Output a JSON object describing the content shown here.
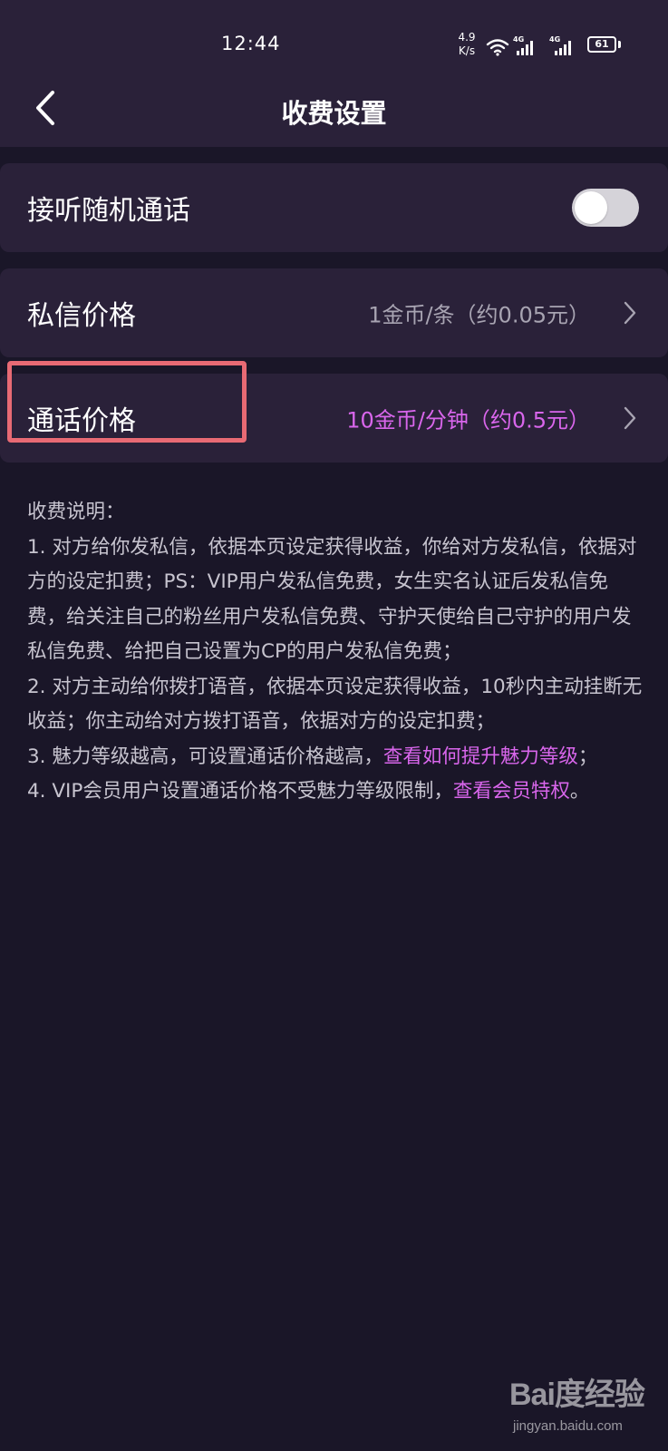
{
  "status_bar": {
    "time": "12:44",
    "net_speed_value": "4.9",
    "net_speed_unit": "K/s",
    "signal_1_label": "4G",
    "signal_2_label": "4G",
    "battery": "61",
    "icons": [
      "wifi-icon",
      "signal-icon",
      "signal-icon",
      "battery-icon"
    ]
  },
  "nav": {
    "title": "收费设置",
    "back_icon": "chevron-left-icon"
  },
  "settings": {
    "random_call": {
      "label": "接听随机通话",
      "enabled": false
    },
    "message_price": {
      "label": "私信价格",
      "value": "1金币/条（约0.05元）"
    },
    "call_price": {
      "label": "通话价格",
      "value": "10金币/分钟（约0.5元）"
    }
  },
  "description": {
    "heading": "收费说明：",
    "item1": "1. 对方给你发私信，依据本页设定获得收益，你给对方发私信，依据对方的设定扣费；PS：VIP用户发私信免费，女生实名认证后发私信免费，给关注自己的粉丝用户发私信免费、守护天使给自己守护的用户发私信免费、给把自己设置为CP的用户发私信免费；",
    "item2": "2. 对方主动给你拨打语音，依据本页设定获得收益，10秒内主动挂断无收益；你主动给对方拨打语音，依据对方的设定扣费；",
    "item3_text": "3. 魅力等级越高，可设置通话价格越高，",
    "item3_link": "查看如何提升魅力等级",
    "item3_end": "；",
    "item4_text": "4. VIP会员用户设置通话价格不受魅力等级限制，",
    "item4_link": "查看会员特权",
    "item4_end": "。"
  },
  "watermark": {
    "logo": "Bai度经验",
    "url": "jingyan.baidu.com"
  },
  "colors": {
    "background": "#1a1628",
    "card": "#2a2139",
    "accent": "#d966ec",
    "muted": "#a8a4b2",
    "highlight": "#e86a74"
  }
}
